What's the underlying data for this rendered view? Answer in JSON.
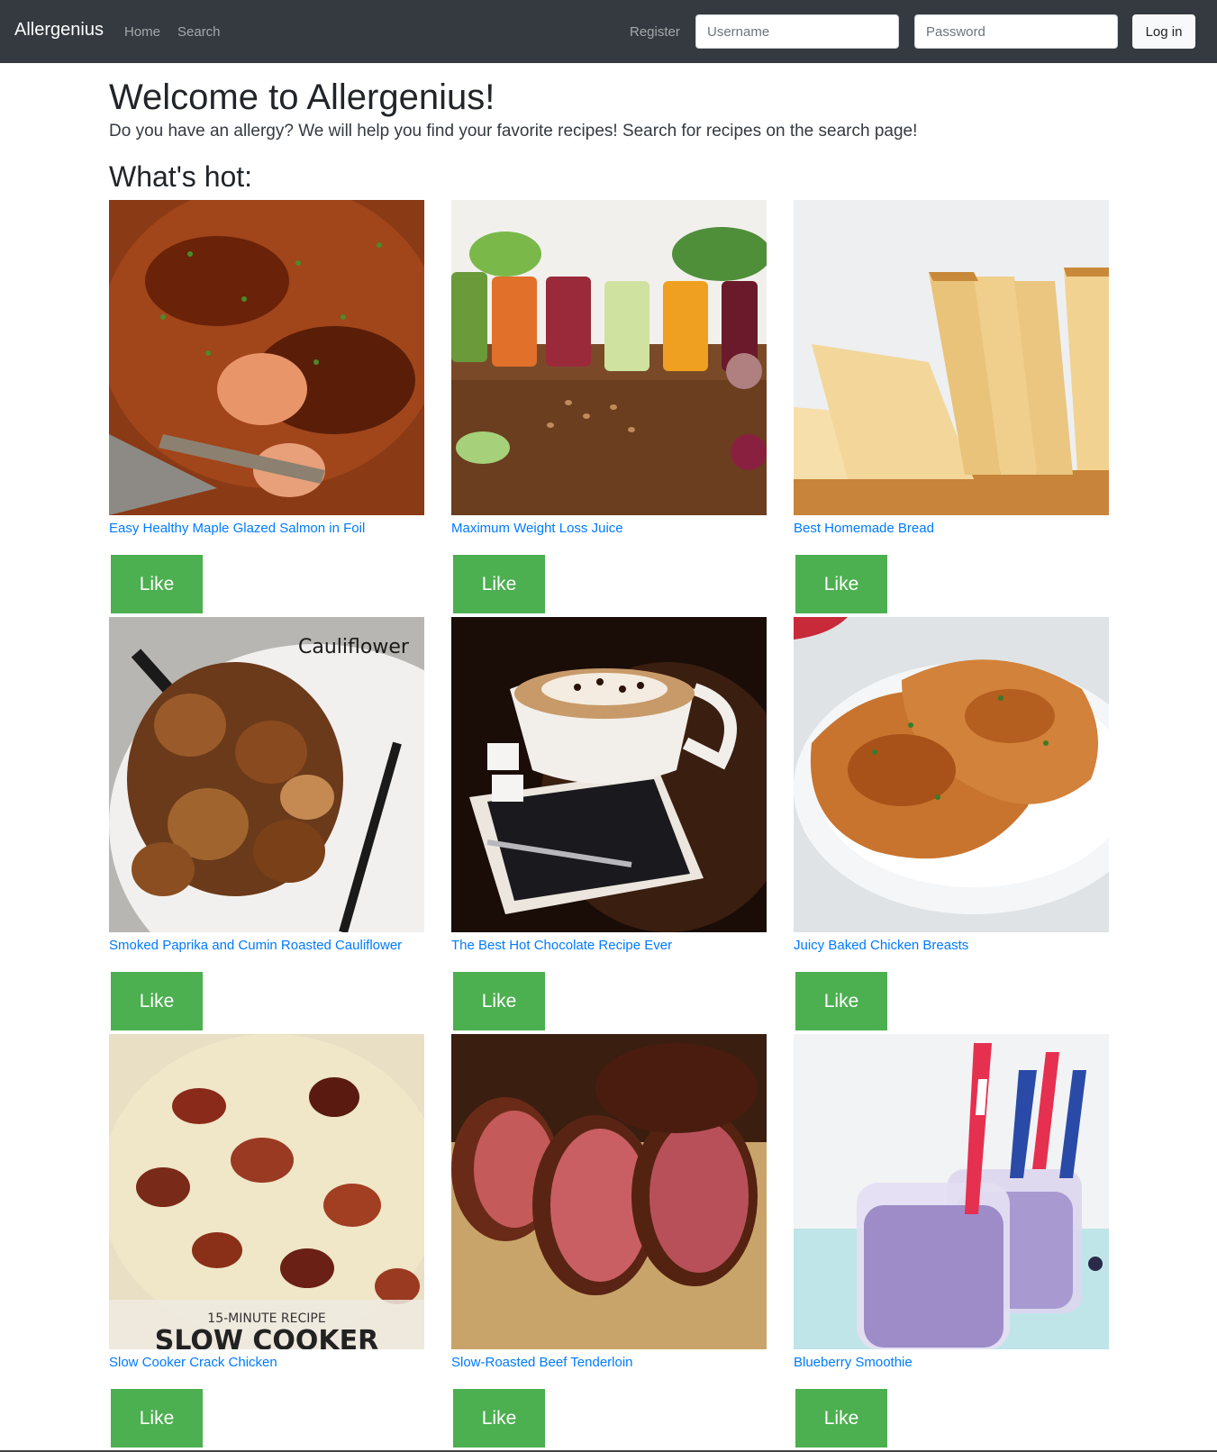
{
  "navbar": {
    "brand": "Allergenius",
    "home": "Home",
    "search": "Search",
    "register": "Register",
    "username_placeholder": "Username",
    "password_placeholder": "Password",
    "login_label": "Log in"
  },
  "main": {
    "title": "Welcome to Allergenius!",
    "lead": "Do you have an allergy? We will help you find your favorite recipes! Search for recipes on the search page!",
    "section_title": "What's hot:",
    "like_label": "Like",
    "recipes": [
      {
        "title": "Easy Healthy Maple Glazed Salmon in Foil",
        "image": "salmon-photo"
      },
      {
        "title": "Maximum Weight Loss Juice",
        "image": "juice-photo"
      },
      {
        "title": "Best Homemade Bread",
        "image": "bread-photo"
      },
      {
        "title": "Smoked Paprika and Cumin Roasted Cauliflower",
        "image": "cauliflower-photo",
        "image_caption": "Cauliflower"
      },
      {
        "title": "The Best Hot Chocolate Recipe Ever",
        "image": "hot-chocolate-photo"
      },
      {
        "title": "Juicy Baked Chicken Breasts",
        "image": "chicken-photo"
      },
      {
        "title": "Slow Cooker Crack Chicken",
        "image": "crack-chicken-photo",
        "image_caption": "15-MINUTE RECIPE",
        "image_caption2": "SLOW COOKER"
      },
      {
        "title": "Slow-Roasted Beef Tenderloin",
        "image": "beef-photo"
      },
      {
        "title": "Blueberry Smoothie",
        "image": "smoothie-photo"
      }
    ]
  },
  "colors": {
    "navbar_bg": "#343a40",
    "link": "#007bff",
    "like_button": "#4caf50"
  }
}
